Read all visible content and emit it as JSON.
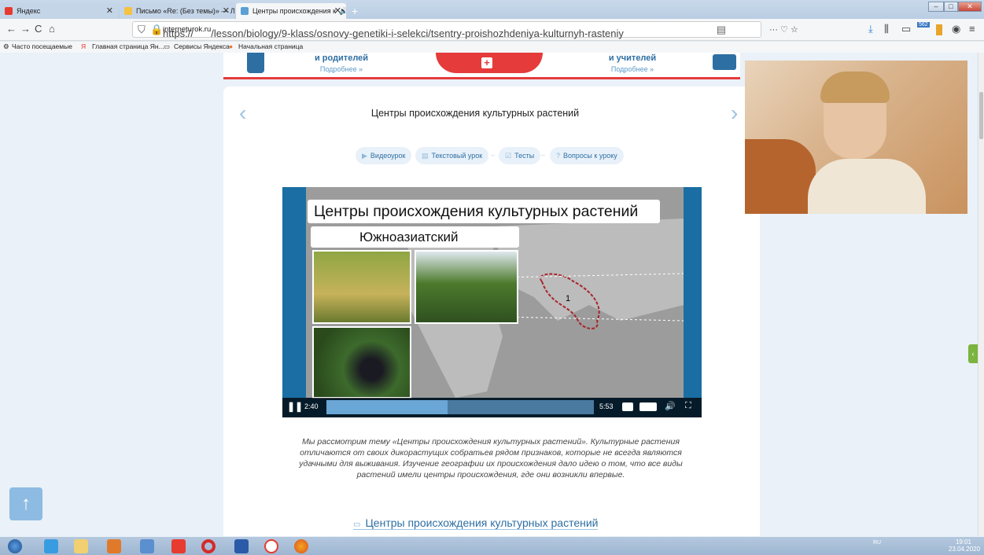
{
  "browser": {
    "tabs": [
      {
        "label": "Яндекс",
        "favicon_color": "#e63b2e"
      },
      {
        "label": "Письмо «Re: (Без темы)» — Л",
        "favicon_color": "#f5c242"
      },
      {
        "label": "Центры происхождения к",
        "favicon_color": "#5aa0d6",
        "active": true
      }
    ],
    "new_tab_label": "+",
    "window_controls": [
      "‒",
      "□",
      "✕"
    ],
    "nav_icons": {
      "back": "←",
      "forward": "→",
      "reload": "C",
      "home": "⌂"
    },
    "url_prefix": "https://",
    "url_host": "interneturok.ru",
    "url_path": "/lesson/biology/9-klass/osnovy-genetiki-i-selekci/tsentry-proishozhdeniya-kulturnyh-rasteniy",
    "url_actions": "··· ♡ ☆",
    "toolbar_right_badge": "562",
    "bookmarks": [
      "Часто посещаемые",
      "Главная страница Ян...",
      "Сервисы Яндекса",
      "Начальная страница"
    ]
  },
  "banner": {
    "left_title": "и родителей",
    "left_more": "Подробнее »",
    "right_title": "и учителей",
    "right_more": "Подробнее »",
    "plus": "+"
  },
  "lesson": {
    "title": "Центры происхождения культурных растений",
    "prev_arrow": "‹",
    "next_arrow": "›",
    "pills": [
      {
        "icon": "▶",
        "label": "Видеоурок"
      },
      {
        "icon": "▤",
        "label": "Текстовый урок"
      },
      {
        "icon": "☑",
        "label": "Тесты"
      },
      {
        "icon": "?",
        "label": "Вопросы к уроку"
      }
    ],
    "separator": "–",
    "video": {
      "slide_title": "Центры происхождения культурных растений",
      "slide_subtitle": "Южноазиатский",
      "map_label": "1",
      "elapsed": "2:40",
      "duration": "5:53",
      "progress": 0.453,
      "speed": "1x",
      "quality": "480p"
    },
    "description": "Мы рассмотрим тему «Центры происхождения культурных растений». Культурные растения отличаются от своих дикорастущих собратьев рядом признаков, которые не всегда являются удачными для выживания. Изучение географии их происхождения дало идею о том, что все виды растений имели центры происхождения, где они возникли впервые.",
    "section_link": "Центры происхождения культурных растений"
  },
  "colors": {
    "accent_blue": "#2e6fa3",
    "brand_red": "#e53b3b",
    "side_tab_green": "#7bb43e"
  },
  "side_tab_label": "‹",
  "up_button_label": "↑",
  "taskbar": {
    "lang": "RU",
    "time": "19:01",
    "date": "23.04.2020"
  }
}
